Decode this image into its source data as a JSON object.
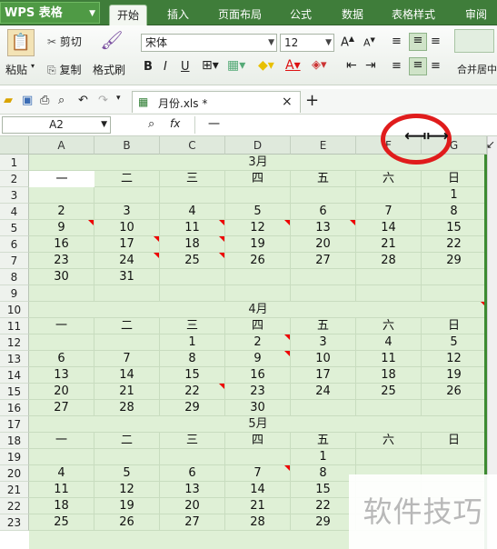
{
  "app": {
    "name": "WPS 表格"
  },
  "tabs": [
    "开始",
    "插入",
    "页面布局",
    "公式",
    "数据",
    "表格样式",
    "审阅"
  ],
  "ribbon": {
    "paste": "粘贴",
    "cut": "剪切",
    "copy": "复制",
    "format_painter": "格式刷",
    "font": "宋体",
    "size": "12",
    "bold": "B",
    "italic": "I",
    "underline": "U",
    "grow": "A",
    "shrink": "A",
    "font_color": "A",
    "merge": "合并居中"
  },
  "document": {
    "tab_title": "月份.xls *",
    "close": "×",
    "new_tab": "+"
  },
  "formula": {
    "namebox": "A2",
    "fx": "fx",
    "content": "一"
  },
  "columns": [
    "A",
    "B",
    "C",
    "D",
    "E",
    "F",
    "G"
  ],
  "rows": [
    "1",
    "2",
    "3",
    "4",
    "5",
    "6",
    "7",
    "8",
    "9",
    "10",
    "11",
    "12",
    "13",
    "14",
    "15",
    "16",
    "17",
    "18",
    "19",
    "20",
    "21",
    "22",
    "23"
  ],
  "titles": {
    "r1": "3月",
    "r10": "4月",
    "r17": "5月"
  },
  "cells": [
    [
      "",
      "",
      "",
      "",
      "",
      "",
      ""
    ],
    [
      "一",
      "二",
      "三",
      "四",
      "五",
      "六",
      "日"
    ],
    [
      "",
      "",
      "",
      "",
      "",
      "",
      "1"
    ],
    [
      "2",
      "3",
      "4",
      "5",
      "6",
      "7",
      "8"
    ],
    [
      "9",
      "10",
      "11",
      "12",
      "13",
      "14",
      "15"
    ],
    [
      "16",
      "17",
      "18",
      "19",
      "20",
      "21",
      "22"
    ],
    [
      "23",
      "24",
      "25",
      "26",
      "27",
      "28",
      "29"
    ],
    [
      "30",
      "31",
      "",
      "",
      "",
      "",
      ""
    ],
    [
      "",
      "",
      "",
      "",
      "",
      "",
      ""
    ],
    [
      "",
      "",
      "",
      "",
      "",
      "",
      ""
    ],
    [
      "一",
      "二",
      "三",
      "四",
      "五",
      "六",
      "日"
    ],
    [
      "",
      "",
      "1",
      "2",
      "3",
      "4",
      "5"
    ],
    [
      "6",
      "7",
      "8",
      "9",
      "10",
      "11",
      "12"
    ],
    [
      "13",
      "14",
      "15",
      "16",
      "17",
      "18",
      "19"
    ],
    [
      "20",
      "21",
      "22",
      "23",
      "24",
      "25",
      "26"
    ],
    [
      "27",
      "28",
      "29",
      "30",
      "",
      "",
      ""
    ],
    [
      "",
      "",
      "",
      "",
      "",
      "",
      ""
    ],
    [
      "一",
      "二",
      "三",
      "四",
      "五",
      "六",
      "日"
    ],
    [
      "",
      "",
      "",
      "",
      "1",
      "",
      ""
    ],
    [
      "4",
      "5",
      "6",
      "7",
      "8",
      "",
      ""
    ],
    [
      "11",
      "12",
      "13",
      "14",
      "15",
      "",
      ""
    ],
    [
      "18",
      "19",
      "20",
      "21",
      "22",
      "",
      ""
    ],
    [
      "25",
      "26",
      "27",
      "28",
      "29",
      "",
      ""
    ]
  ],
  "watermark": "软件技巧"
}
